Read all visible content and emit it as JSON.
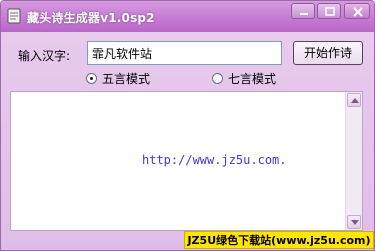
{
  "window": {
    "title": "藏头诗生成器v1.0sp2",
    "icon": "notebook-icon",
    "controls": [
      "minimize-icon",
      "maximize-icon",
      "close-icon"
    ]
  },
  "form": {
    "input_label": "输入汉字:",
    "input_value": "霏凡软件站",
    "start_button": "开始作诗",
    "modes": [
      {
        "label": "五言模式",
        "selected": true
      },
      {
        "label": "七言模式",
        "selected": false
      }
    ]
  },
  "output": {
    "text": "http://www.jz5u.com."
  },
  "watermark": {
    "text": "JZ5U绿色下载站(www.jz5u.com)"
  },
  "colors": {
    "titlebar": "#c77bd4",
    "window_bg": "#e5c6ec",
    "link_text": "#3f3ad0",
    "watermark_bg": "#ffe600"
  }
}
